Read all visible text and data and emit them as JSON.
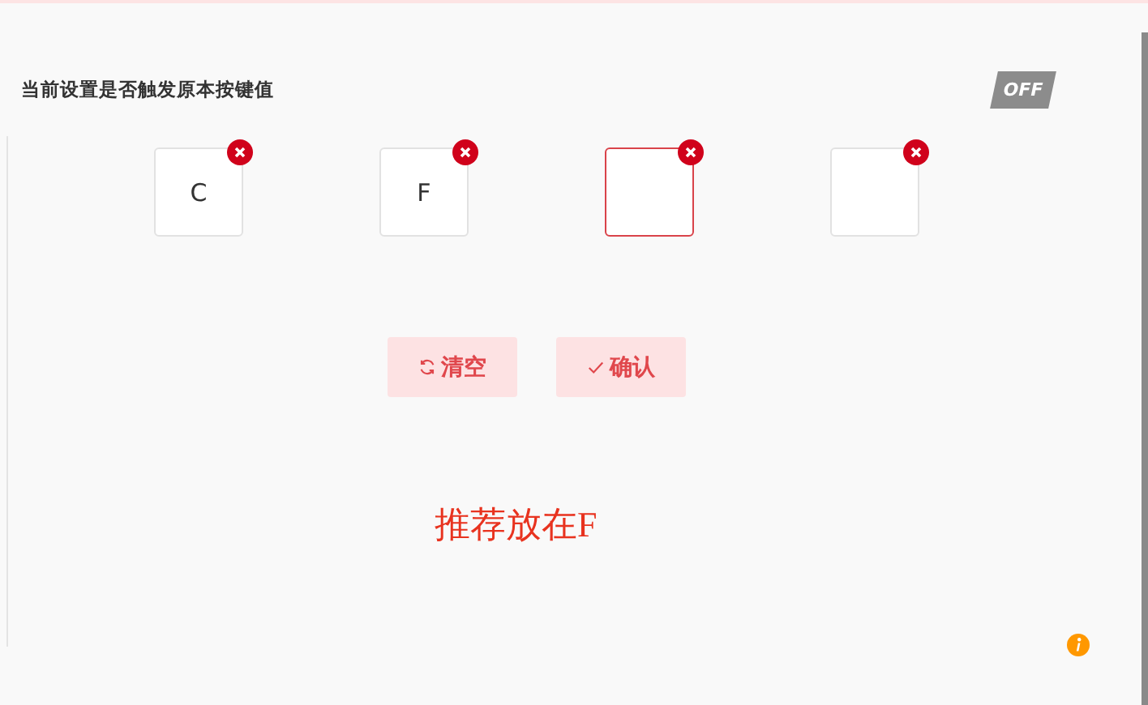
{
  "setting": {
    "label": "当前设置是否触发原本按键值",
    "toggle": {
      "text": "OFF",
      "on": false
    }
  },
  "keys": [
    {
      "value": "C",
      "selected": false
    },
    {
      "value": "F",
      "selected": false
    },
    {
      "selected": true
    },
    {
      "selected": false
    }
  ],
  "buttons": [
    {
      "kind": "clear",
      "label": "清空"
    },
    {
      "kind": "confirm",
      "label": "确认"
    }
  ],
  "hint": "推荐放在F"
}
